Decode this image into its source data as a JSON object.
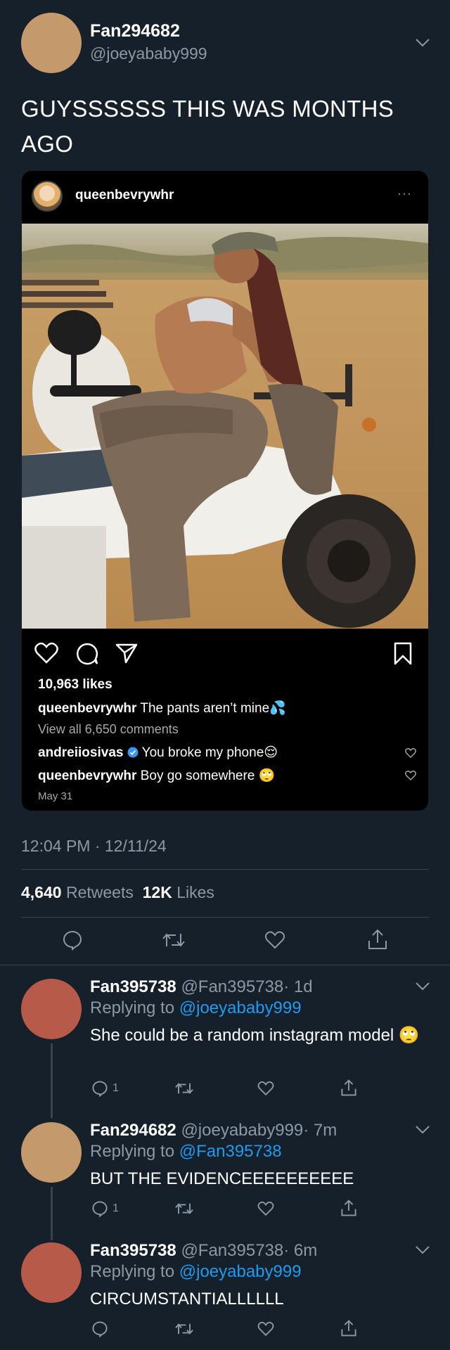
{
  "tweet": {
    "author_name": "Fan294682",
    "author_handle": "@joeyababy999",
    "text": "GUYSSSSSS THIS WAS MONTHS AGO",
    "timestamp": "12:04 PM · 12/11/24",
    "retweets_count": "4,640",
    "retweets_label": "Retweets",
    "likes_count": "12K",
    "likes_label": "Likes",
    "avatar_color": "#c49a6c"
  },
  "instagram_embed": {
    "username": "queenbevrywhr",
    "more_label": "···",
    "likes": "10,963 likes",
    "caption_user": "queenbevrywhr",
    "caption_text": "The pants aren’t mine💦",
    "view_all": "View all 6,650 comments",
    "comments": [
      {
        "user": "andreiiosivas",
        "verified": true,
        "text": "You broke my phone😌"
      },
      {
        "user": "queenbevrywhr",
        "verified": false,
        "text": "Boy go somewhere 🙄"
      }
    ],
    "date": "May 31"
  },
  "replies": [
    {
      "name": "Fan395738",
      "handle": "@Fan395738",
      "time": "· 1d",
      "replying_label": "Replying to",
      "replying_to": "@joeyababy999",
      "text": "She could be a random instagram model 🙄",
      "reply_count": "1",
      "avatar_color": "#b85a4a"
    },
    {
      "name": "Fan294682",
      "handle": "@joeyababy999",
      "time": "· 7m",
      "replying_label": "Replying to",
      "replying_to": "@Fan395738",
      "text": "BUT THE EVIDENCEEEEEEEEEE",
      "reply_count": "1",
      "avatar_color": "#c49a6c"
    },
    {
      "name": "Fan395738",
      "handle": "@Fan395738",
      "time": "· 6m",
      "replying_label": "Replying to",
      "replying_to": "@joeyababy999",
      "text": "CIRCUMSTANTIALLLLLL",
      "reply_count": "",
      "avatar_color": "#b85a4a"
    }
  ],
  "colors": {
    "background": "#15202b",
    "muted": "#8b98a5",
    "link": "#1d9bf0",
    "divider": "#38444d"
  }
}
